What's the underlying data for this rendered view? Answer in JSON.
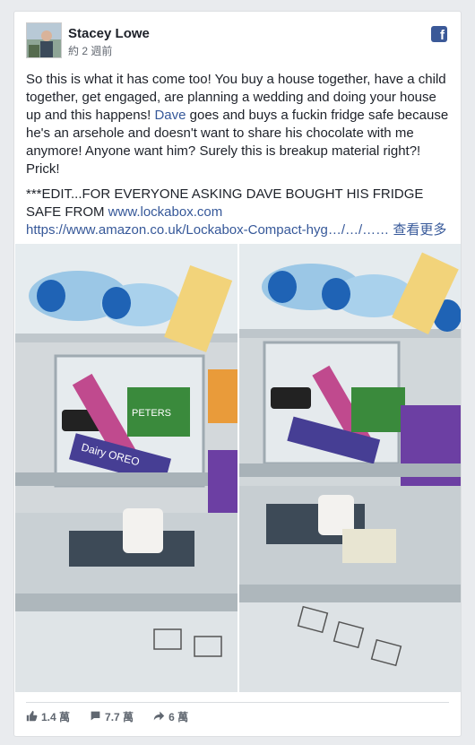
{
  "post": {
    "author": "Stacey Lowe",
    "time": "約 2 週前",
    "body_pre": "So this is what it has come too! You buy a house together, have a child together, get engaged, are planning a wedding and doing your house up and this happens! ",
    "mention": "Dave",
    "body_post": " goes and buys a fuckin fridge safe because he's an arsehole and doesn't want to share his chocolate with me anymore! Anyone want him? Surely this is breakup material right?! Prick!",
    "edit_text": "***EDIT...FOR EVERYONE ASKING DAVE BOUGHT HIS FRIDGE SAFE FROM ",
    "edit_link": "www.lockabox.com",
    "url": "https://www.amazon.co.uk/Lockabox-Compact-hyg…/…/……",
    "see_more": "查看更多"
  },
  "stats": {
    "likes": "1.4 萬",
    "comments": "7.7 萬",
    "shares": "6 萬"
  },
  "photo_labels": {
    "brand1": "PETERS KEDDR",
    "brand2": "Dairy OREO"
  },
  "colors": {
    "facebook_blue": "#3b5998",
    "link": "#365899"
  }
}
